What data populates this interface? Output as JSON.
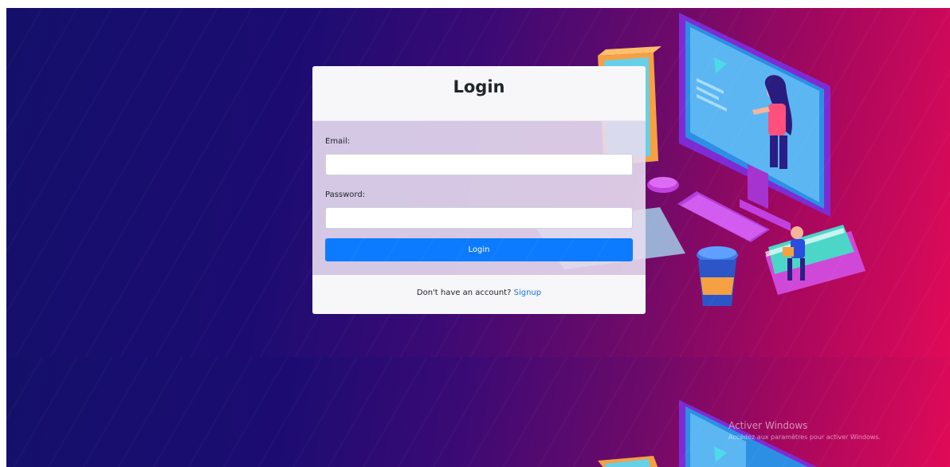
{
  "login_card": {
    "title": "Login",
    "email_label": "Email:",
    "email_value": "",
    "password_label": "Password:",
    "password_value": "",
    "submit_label": "Login",
    "footer_text": "Don't have an account?",
    "signup_label": "Signup"
  },
  "watermark": {
    "title": "Activer Windows",
    "subtitle": "Accédez aux paramètres pour activer Windows."
  },
  "colors": {
    "primary_button": "#0d7bff",
    "link": "#1a73e8",
    "background_left": "#14106a",
    "background_right": "#e00a58"
  },
  "illustration": {
    "icons": [
      "desktop-monitor-icon",
      "presenter-woman-icon",
      "play-icon",
      "keyboard-icon",
      "mouse-icon",
      "coffee-cup-icon",
      "book-stack-icon",
      "reading-person-icon"
    ]
  }
}
